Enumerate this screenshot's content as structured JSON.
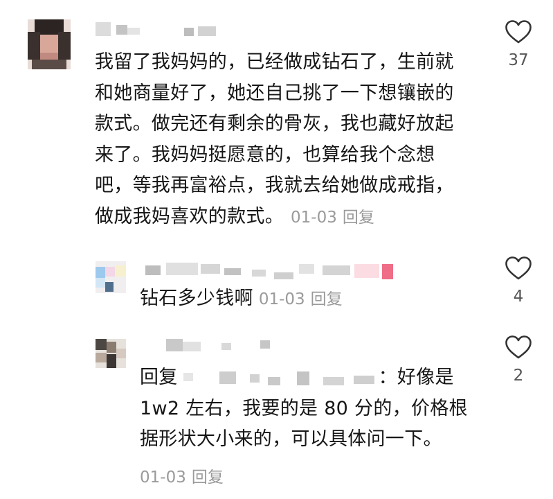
{
  "comments": [
    {
      "text": "我留了我妈妈的，已经做成钻石了，生前就和她商量好了，她还自己挑了一下想镶嵌的款式。做完还有剩余的骨灰，我也藏好放起来了。我妈妈挺愿意的，也算给我个念想吧，等我再富裕点，我就去给她做成戒指，做成我妈喜欢的款式。",
      "lines": [
        "我留了我妈妈的，已经做成钻石了，生前就",
        "和她商量好了，她还自己挑了一下想镶嵌的",
        "款式。做完还有剩余的骨灰，我也藏好放起",
        "来了。我妈妈挺愿意的，也算给我个念想",
        "吧，等我再富裕点，我就去给她做成戒指，",
        "做成我妈喜欢的款式。"
      ],
      "date": "01-03",
      "reply_label": "回复",
      "likes": "37"
    },
    {
      "text": "钻石多少钱啊",
      "date": "01-03",
      "reply_label": "回复",
      "likes": "4"
    },
    {
      "reply_prefix": "回复",
      "lines": [
        "：好像是",
        "1w2 左右，我要的是 80 分的，价格根",
        "据形状大小来的，可以具体问一下。"
      ],
      "date": "01-03",
      "reply_label": "回复",
      "likes": "2"
    }
  ],
  "icons": {
    "like": "heart-outline-icon"
  },
  "colors": {
    "text": "#161616",
    "meta": "#9a9a9a",
    "count": "#555555",
    "heart": "#333333"
  }
}
